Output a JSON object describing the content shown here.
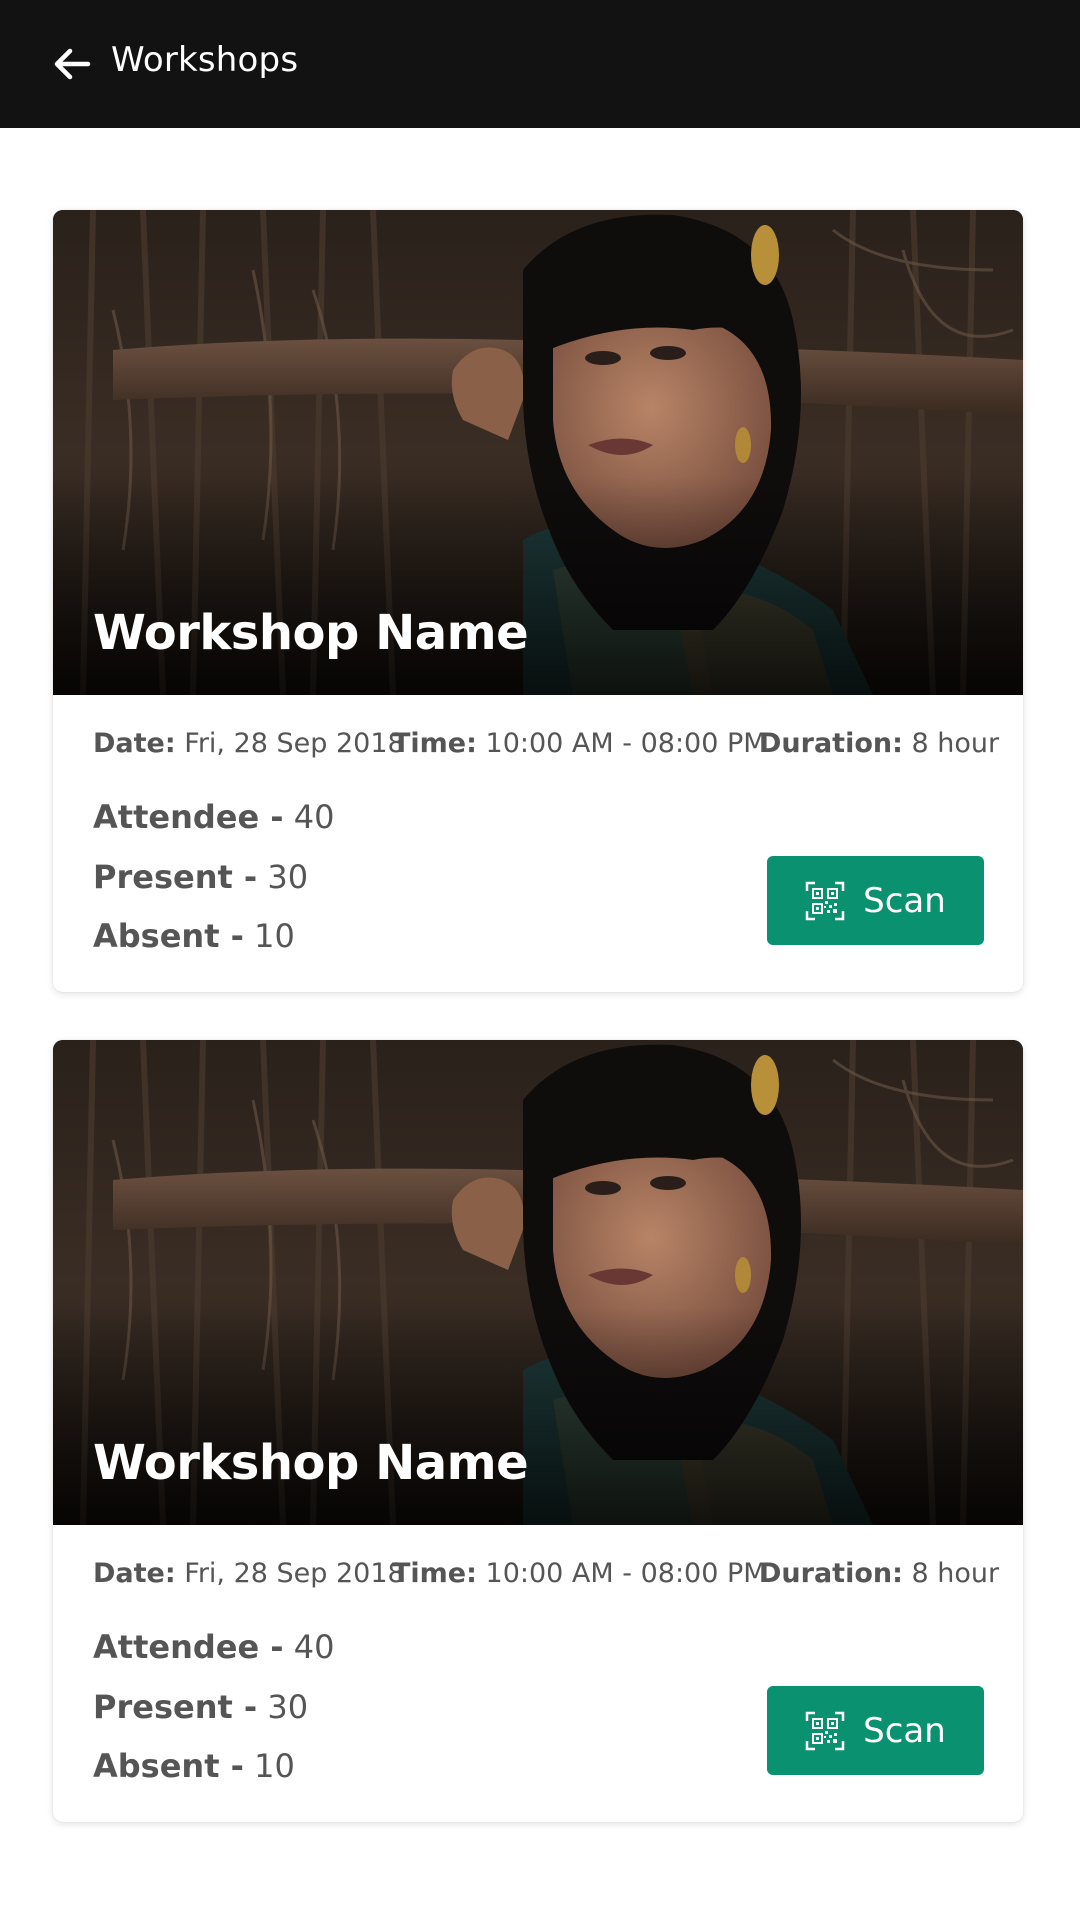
{
  "appbar": {
    "title": "Workshops",
    "back_icon": "arrow-left-icon"
  },
  "workshops": [
    {
      "name": "Workshop Name",
      "date_label": "Date:",
      "date": "Fri, 28 Sep 2018",
      "time_label": "Time:",
      "time": "10:00 AM - 08:00 PM",
      "duration_label": "Duration:",
      "duration": "8 hour",
      "attendee_label": "Attendee -",
      "attendee": "40",
      "present_label": "Present -",
      "present": "30",
      "absent_label": "Absent -",
      "absent": "10",
      "scan_label": "Scan",
      "scan_icon": "qr-scan-icon"
    },
    {
      "name": "Workshop Name",
      "date_label": "Date:",
      "date": "Fri, 28 Sep 2018",
      "time_label": "Time:",
      "time": "10:00 AM - 08:00 PM",
      "duration_label": "Duration:",
      "duration": "8 hour",
      "attendee_label": "Attendee -",
      "attendee": "40",
      "present_label": "Present -",
      "present": "30",
      "absent_label": "Absent -",
      "absent": "10",
      "scan_label": "Scan",
      "scan_icon": "qr-scan-icon"
    }
  ],
  "colors": {
    "appbar": "#121212",
    "scan_button": "#0a9170",
    "text": "#555555"
  }
}
